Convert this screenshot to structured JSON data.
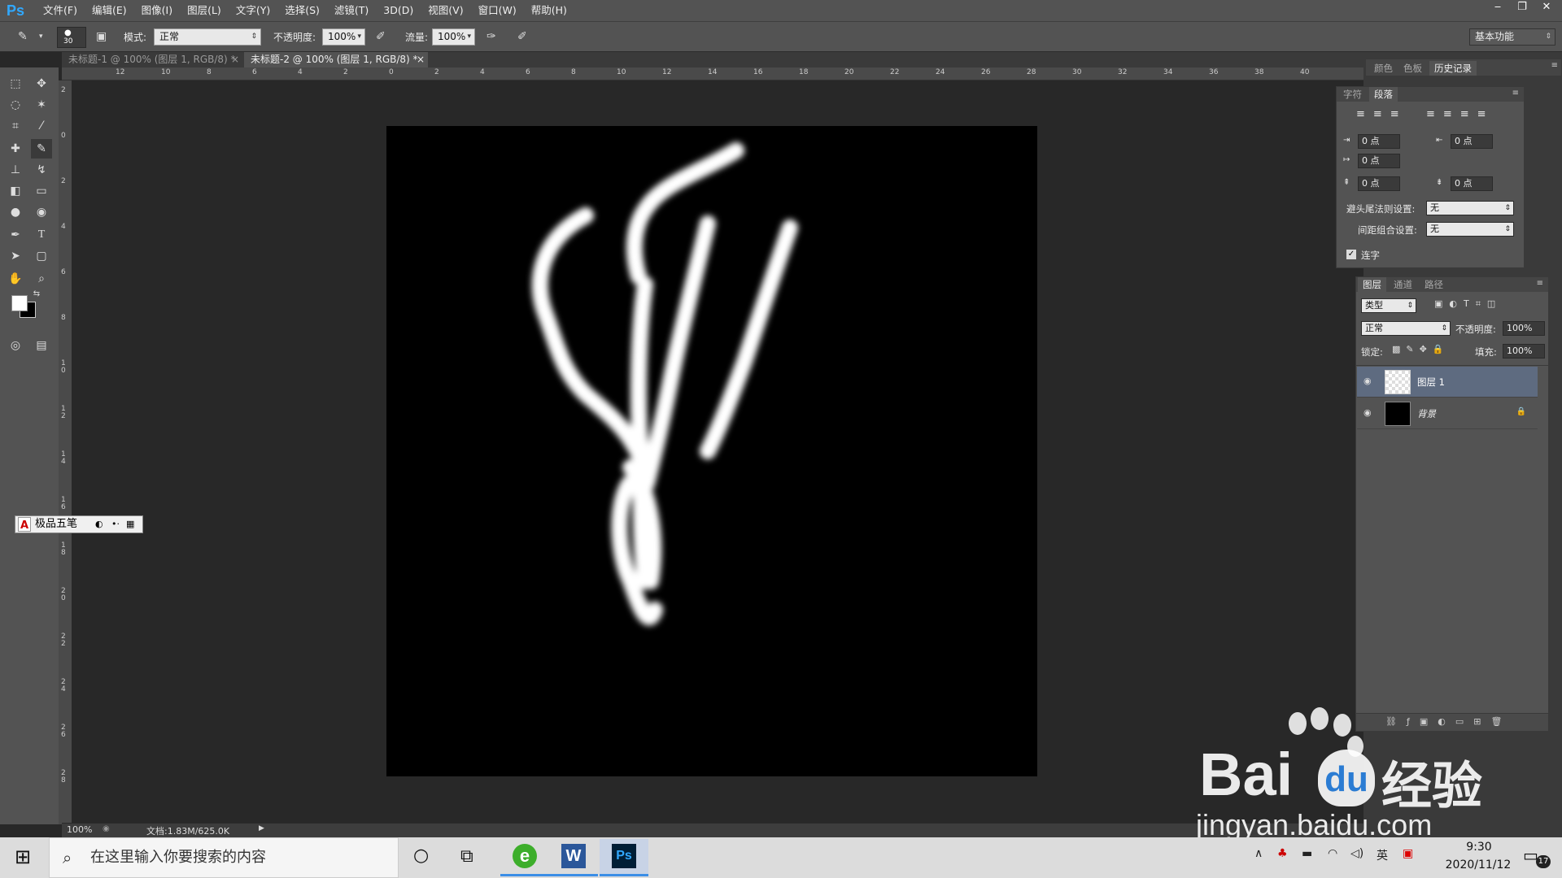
{
  "menubar": {
    "logo": "Ps",
    "items": [
      "文件(F)",
      "编辑(E)",
      "图像(I)",
      "图层(L)",
      "文字(Y)",
      "选择(S)",
      "滤镜(T)",
      "3D(D)",
      "视图(V)",
      "窗口(W)",
      "帮助(H)"
    ],
    "win_min": "‒",
    "win_restore": "❐",
    "win_close": "✕"
  },
  "options": {
    "brush_size": "30",
    "mode_label": "模式:",
    "mode_value": "正常",
    "opacity_label": "不透明度:",
    "opacity_value": "100%",
    "flow_label": "流量:",
    "flow_value": "100%",
    "workspace": "基本功能"
  },
  "tabs": [
    {
      "label": "未标题-1 @ 100% (图层 1, RGB/8) *",
      "close": "×"
    },
    {
      "label": "未标题-2 @ 100% (图层 1, RGB/8) *",
      "close": "×"
    }
  ],
  "ruler_top": [
    "12",
    "10",
    "8",
    "6",
    "4",
    "2",
    "0",
    "2",
    "4",
    "6",
    "8",
    "10",
    "12",
    "14",
    "16",
    "18",
    "20",
    "22",
    "24",
    "26",
    "28",
    "30",
    "32",
    "34",
    "36",
    "38",
    "40"
  ],
  "ruler_left": [
    "2",
    "0",
    "2",
    "4",
    "6",
    "8",
    "10",
    "12",
    "14",
    "16",
    "18",
    "20",
    "22",
    "24",
    "26",
    "28"
  ],
  "status": {
    "zoom": "100%",
    "doc": "文档:1.83M/625.0K"
  },
  "ime": {
    "label": "极品五笔"
  },
  "panel_top_tabs": [
    "颜色",
    "色板",
    "历史记录"
  ],
  "para_panel": {
    "tabs": [
      "字符",
      "段落"
    ],
    "indent_left": "0 点",
    "indent_right": "0 点",
    "indent_first": "0 点",
    "space_before": "0 点",
    "space_after": "0 点",
    "kinsoku_label": "避头尾法则设置:",
    "kinsoku_value": "无",
    "mojikumi_label": "间距组合设置:",
    "mojikumi_value": "无",
    "hyphen_label": "连字"
  },
  "layers_panel": {
    "tabs": [
      "图层",
      "通道",
      "路径"
    ],
    "filter": "类型",
    "blend": "正常",
    "opacity_label": "不透明度:",
    "opacity_value": "100%",
    "lock_label": "锁定:",
    "fill_label": "填充:",
    "fill_value": "100%",
    "layers": [
      {
        "name": "图层 1",
        "selected": true
      },
      {
        "name": "背景",
        "locked": true
      }
    ]
  },
  "taskbar": {
    "search_placeholder": "在这里输入你要搜索的内容",
    "time": "9:30",
    "date": "2020/11/12",
    "ime_indicator": "英",
    "notif_count": "17"
  },
  "watermark": {
    "brand": "Bai",
    "brand2": "du",
    "suffix": "经验",
    "url": "jingyan.baidu.com"
  },
  "colors": {
    "ps_blue": "#31a8ff",
    "panel_bg": "#535353",
    "canvas": "#000000"
  }
}
